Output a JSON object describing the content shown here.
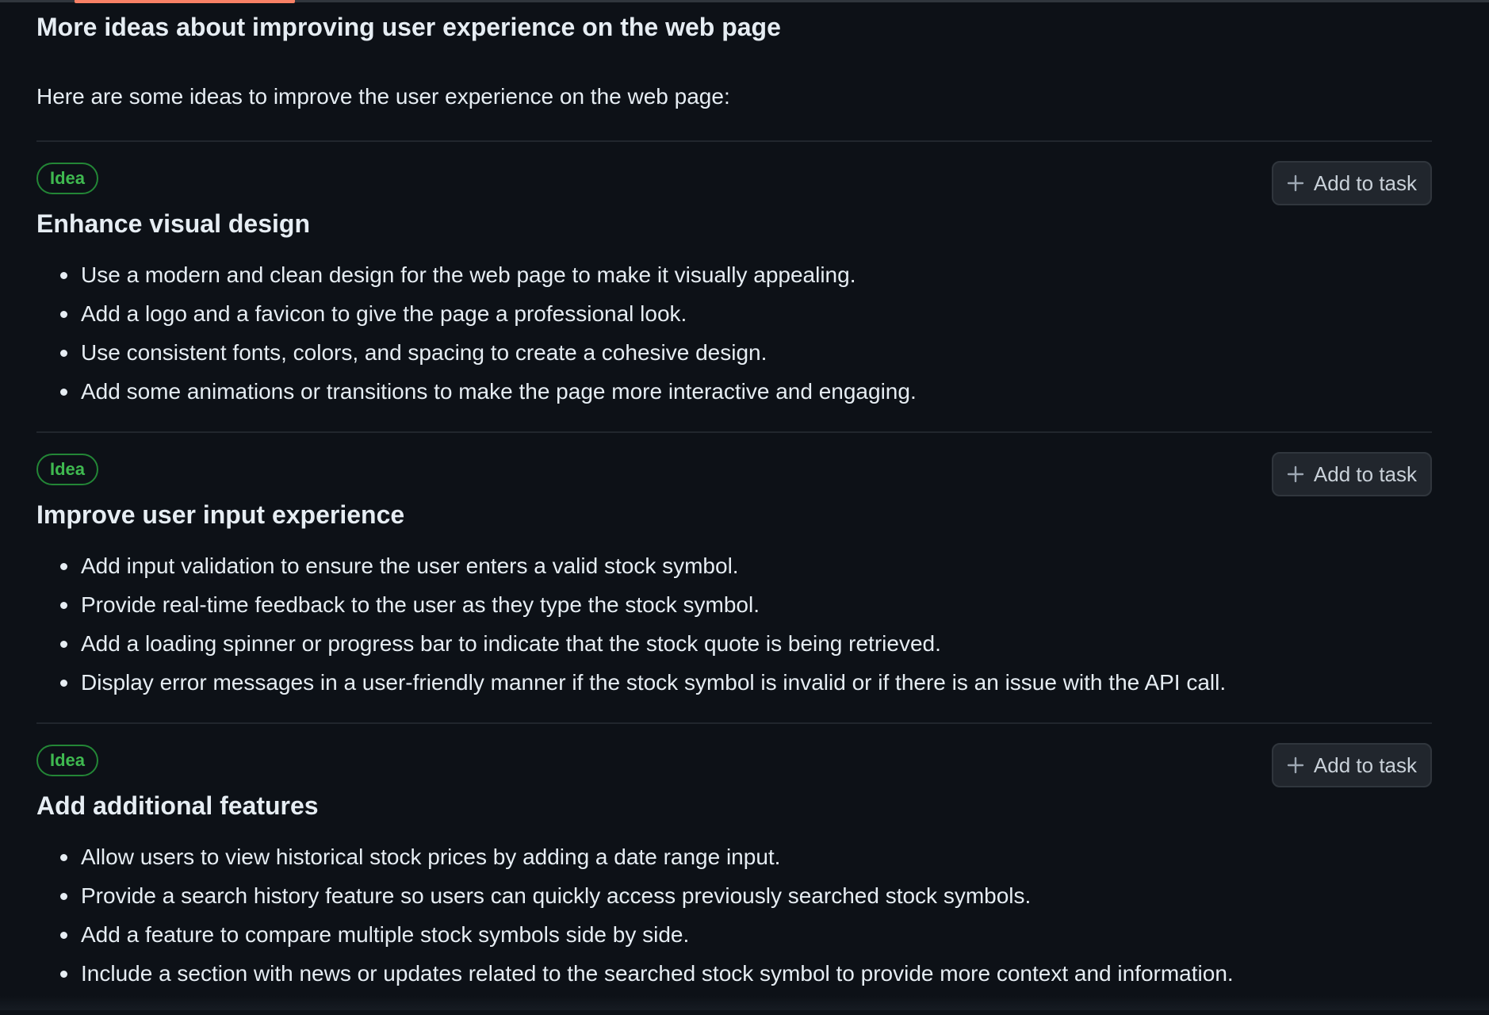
{
  "page": {
    "title": "More ideas about improving user experience on the web page",
    "intro": "Here are some ideas to improve the user experience on the web page:"
  },
  "ideas": [
    {
      "badge": "Idea",
      "title": "Enhance visual design",
      "button_label": "Add to task",
      "items": [
        "Use a modern and clean design for the web page to make it visually appealing.",
        "Add a logo and a favicon to give the page a professional look.",
        "Use consistent fonts, colors, and spacing to create a cohesive design.",
        "Add some animations or transitions to make the page more interactive and engaging."
      ]
    },
    {
      "badge": "Idea",
      "title": "Improve user input experience",
      "button_label": "Add to task",
      "items": [
        "Add input validation to ensure the user enters a valid stock symbol.",
        "Provide real-time feedback to the user as they type the stock symbol.",
        "Add a loading spinner or progress bar to indicate that the stock quote is being retrieved.",
        "Display error messages in a user-friendly manner if the stock symbol is invalid or if there is an issue with the API call."
      ]
    },
    {
      "badge": "Idea",
      "title": "Add additional features",
      "button_label": "Add to task",
      "items": [
        "Allow users to view historical stock prices by adding a date range input.",
        "Provide a search history feature so users can quickly access previously searched stock symbols.",
        "Add a feature to compare multiple stock symbols side by side.",
        "Include a section with news or updates related to the searched stock symbol to provide more context and information."
      ]
    }
  ],
  "colors": {
    "background": "#0d1117",
    "badge_green": "#3fb950",
    "active_tab_accent": "#f78166"
  },
  "icons": {
    "add_button_icon": "plus-icon"
  }
}
